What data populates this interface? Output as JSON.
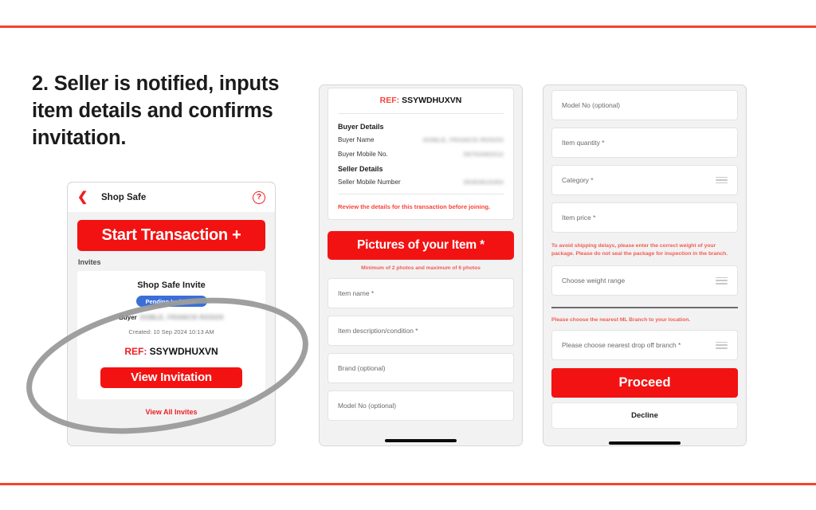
{
  "heading": "2. Seller is notified, inputs item details and confirms invitation.",
  "accent": {
    "red": "#f31212",
    "rule_red": "#f4442e",
    "note_red": "#f15c52",
    "badge_blue": "#3a6fd8",
    "annotation_gray": "#9a9a9a"
  },
  "phone1": {
    "header": {
      "back_icon": "chevron-left-icon",
      "title": "Shop Safe",
      "help_icon": "question-mark-circle-icon"
    },
    "start_transaction_label": "Start Transaction +",
    "invites_label": "Invites",
    "invite_card": {
      "title": "Shop Safe Invite",
      "status_badge": "Pending Invitation",
      "buyer_label": "Buyer",
      "buyer_value": "DOBLE, FRANCIS ROSOS",
      "created": "Created: 10 Sep 2024 10:13 AM",
      "ref_key": "REF:",
      "ref_value": "SSYWDHUXVN",
      "view_invitation_label": "View Invitation"
    },
    "view_all_invites_label": "View All Invites"
  },
  "phone2": {
    "ref_key": "REF:",
    "ref_value": "SSYWDHUXVN",
    "buyer_section_title": "Buyer Details",
    "rows": [
      {
        "label": "Buyer Name",
        "value": "DOBLE, FRANCIS ROSOS"
      },
      {
        "label": "Buyer Mobile No.",
        "value": "09753482312"
      }
    ],
    "seller_section_title": "Seller Details",
    "seller_rows": [
      {
        "label": "Seller Mobile Number",
        "value": "09453816494"
      }
    ],
    "review_note": "Review the details for this transaction before joining.",
    "pictures_button_label": "Pictures of your Item *",
    "photos_note": "Minimum of 2 photos and maximum of 6 photos",
    "fields": [
      {
        "label": "Item name *",
        "icon": null
      },
      {
        "label": "Item description/condition *",
        "icon": null
      },
      {
        "label": "Brand (optional)",
        "icon": null
      },
      {
        "label": "Model No (optional)",
        "icon": null
      }
    ]
  },
  "phone3": {
    "fields_top": [
      {
        "label": "Model No (optional)",
        "icon": null
      },
      {
        "label": "Item quantity *",
        "icon": null
      },
      {
        "label": "Category *",
        "icon": "list-icon"
      },
      {
        "label": "Item price *",
        "icon": null
      }
    ],
    "weight_note": "To avoid shipping delays, please enter the correct weight of your package. Please do not seal the package for inspection in the branch.",
    "weight_field": {
      "label": "Choose weight range",
      "icon": "list-icon"
    },
    "branch_note": "Please choose the nearest ML Branch to your location.",
    "branch_field": {
      "label": "Please choose nearest drop off branch *",
      "icon": "list-icon"
    },
    "proceed_label": "Proceed",
    "decline_label": "Decline"
  }
}
